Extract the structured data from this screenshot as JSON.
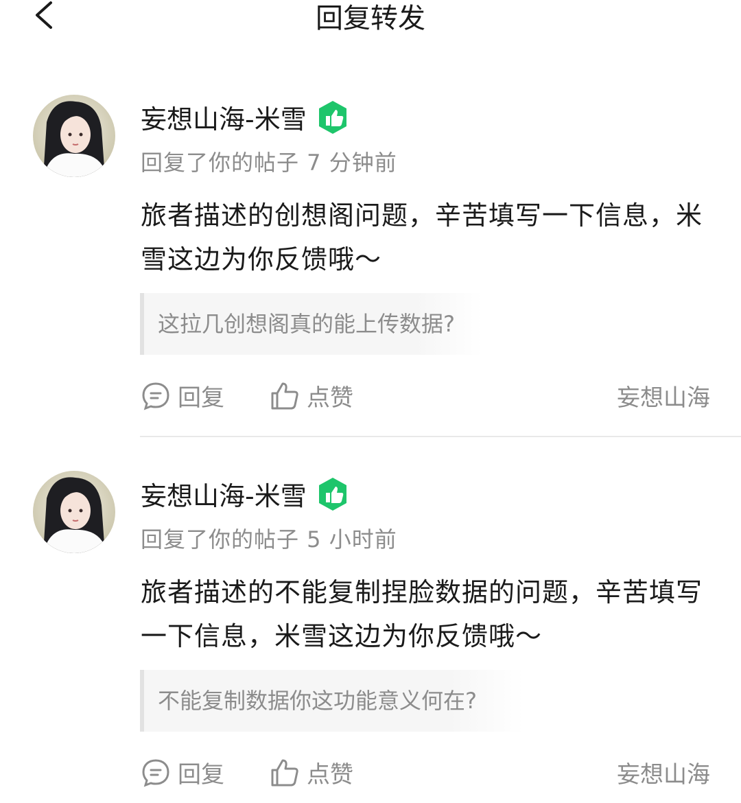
{
  "header": {
    "title": "回复转发"
  },
  "items": [
    {
      "user": "妄想山海-米雪",
      "meta": "回复了你的帖子 7 分钟前",
      "content": "旅者描述的创想阁问题，辛苦填写一下信息，米雪这边为你反馈哦～",
      "quote": "这拉几创想阁真的能上传数据?",
      "reply_label": "回复",
      "like_label": "点赞",
      "source": "妄想山海"
    },
    {
      "user": "妄想山海-米雪",
      "meta": "回复了你的帖子 5 小时前",
      "content": "旅者描述的不能复制捏脸数据的问题，辛苦填写一下信息，米雪这边为你反馈哦～",
      "quote": "不能复制数据你这功能意义何在?",
      "reply_label": "回复",
      "like_label": "点赞",
      "source": "妄想山海"
    }
  ],
  "colors": {
    "badge": "#1ec56b",
    "muted": "#8c8c8c",
    "text": "#1a1a1a"
  },
  "icons": {
    "back": "chevron-left-icon",
    "badge": "thumbs-up-badge-icon",
    "reply": "chat-bubble-icon",
    "like": "thumbs-up-icon"
  }
}
